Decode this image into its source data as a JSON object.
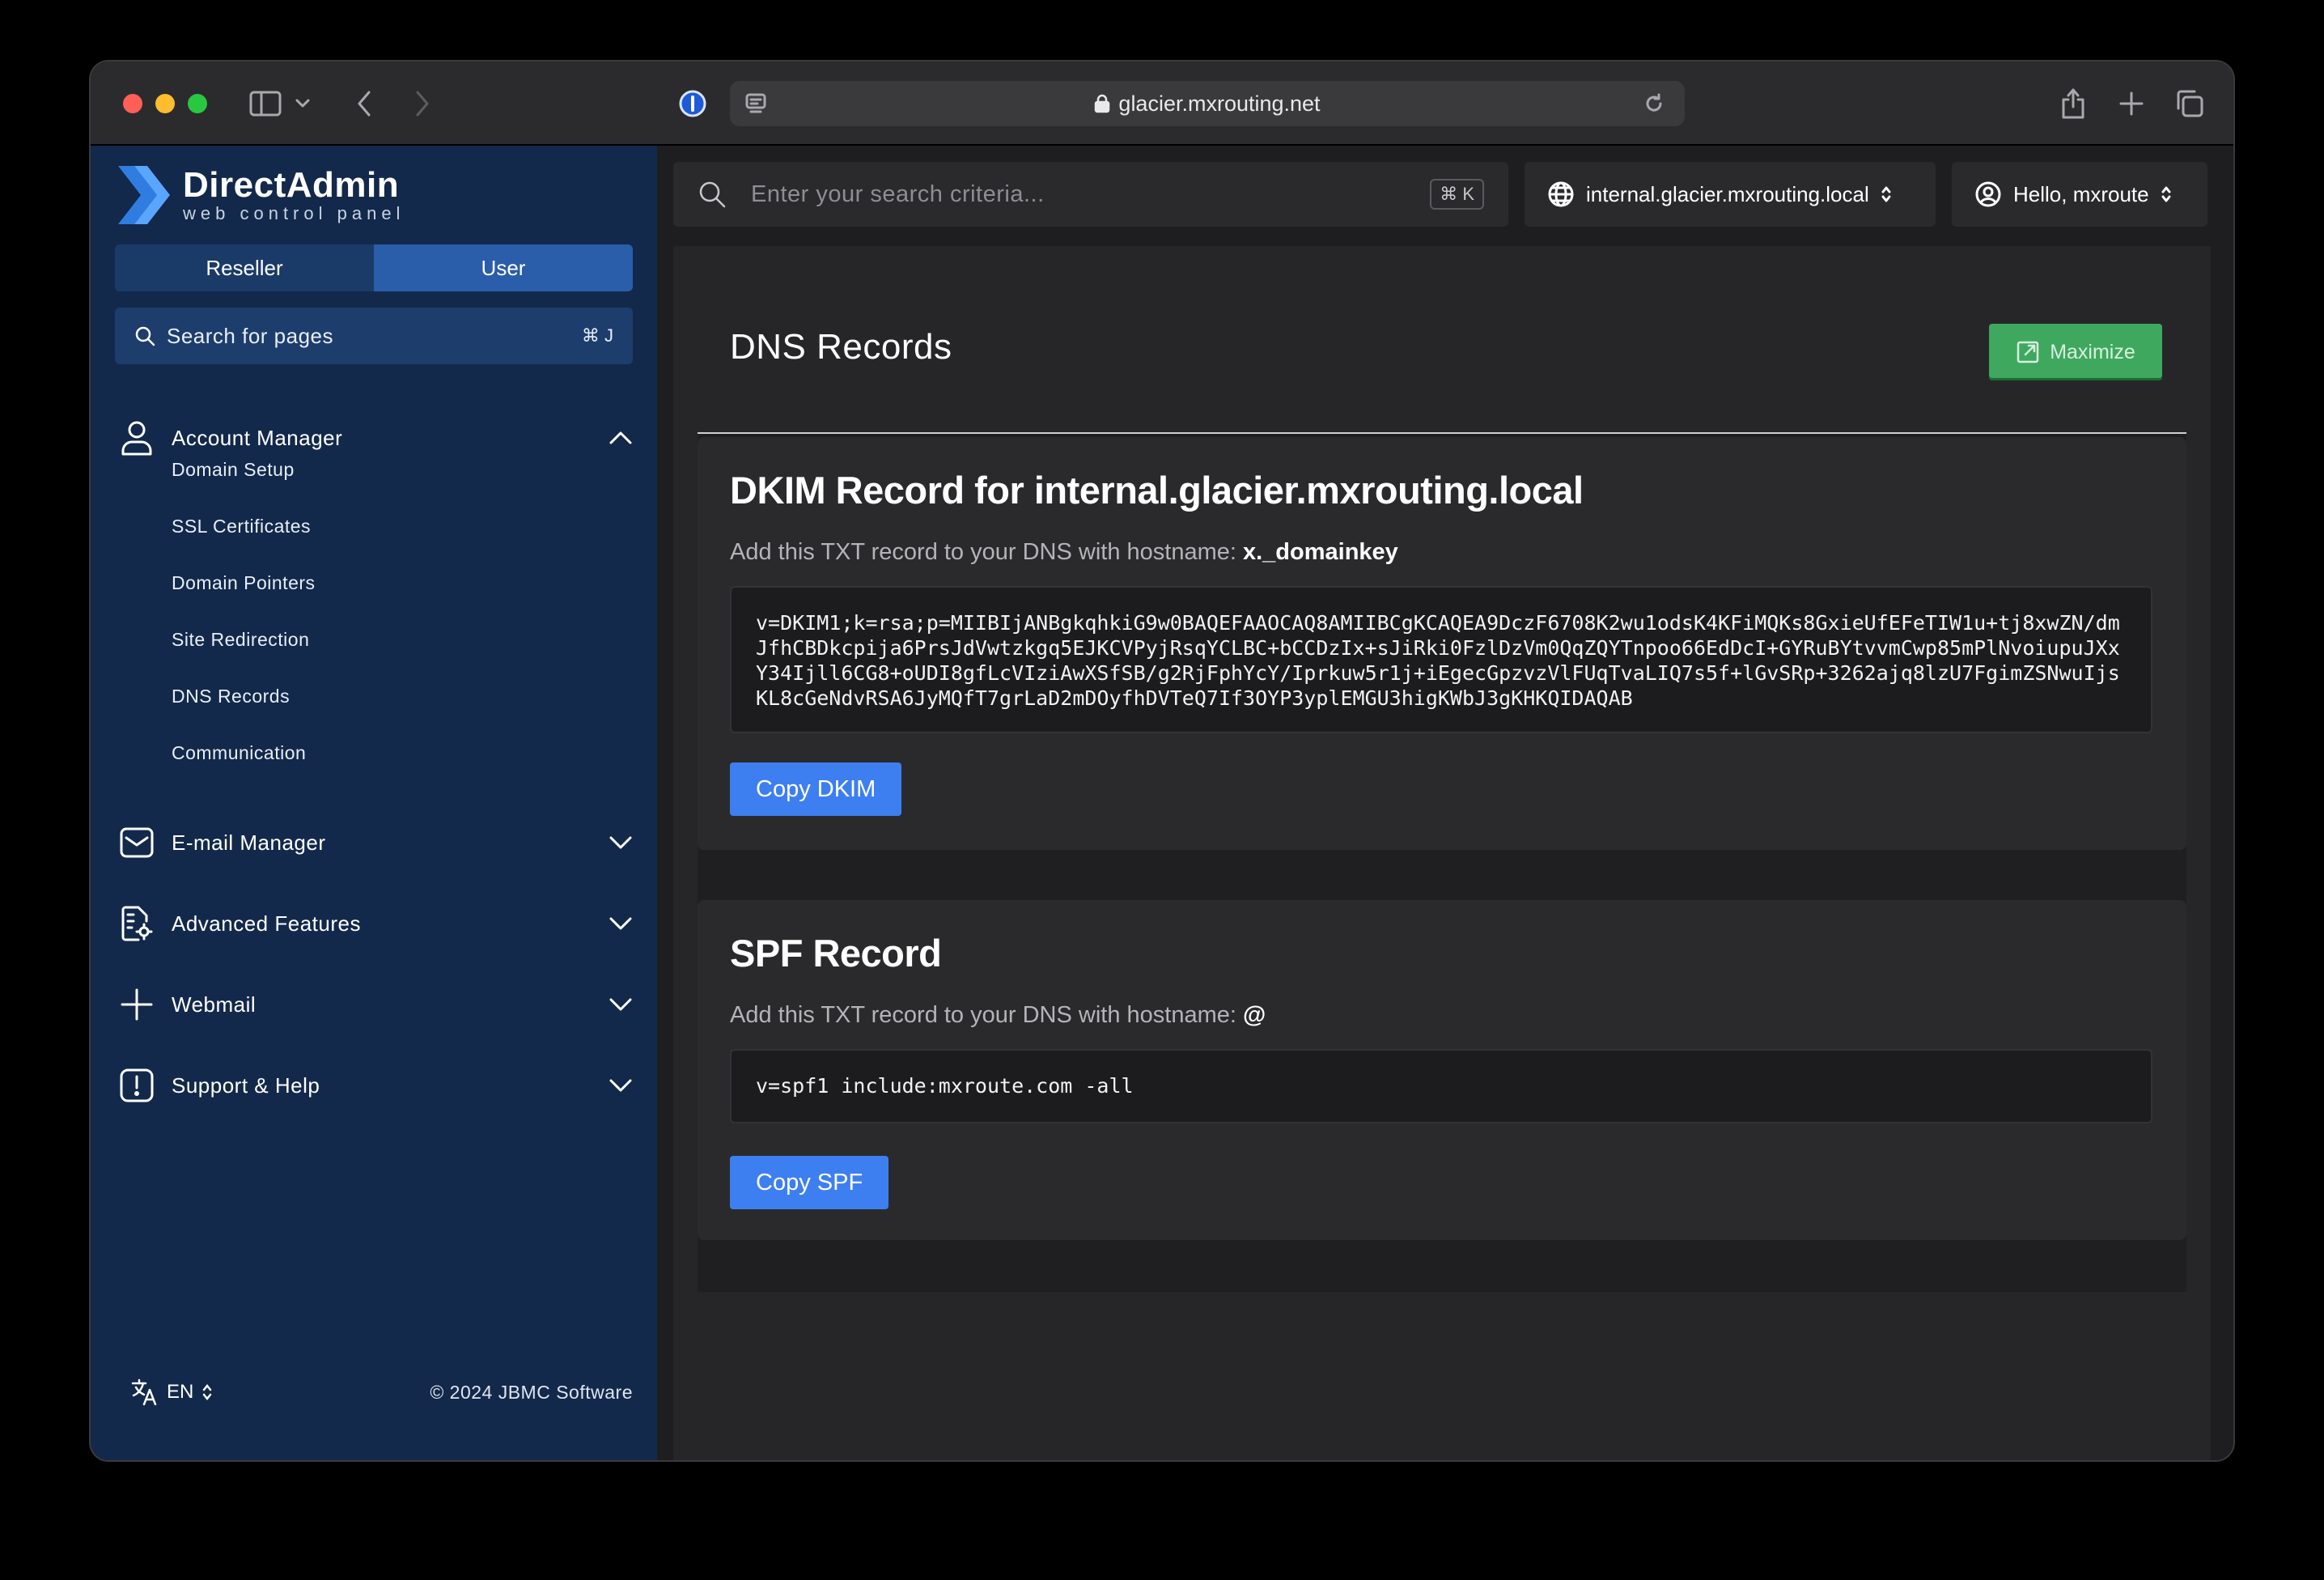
{
  "browser": {
    "url": "glacier.mxrouting.net"
  },
  "brand": {
    "title": "DirectAdmin",
    "subtitle": "web control panel"
  },
  "sidebar": {
    "tabs": [
      {
        "label": "Reseller",
        "active": false
      },
      {
        "label": "User",
        "active": true
      }
    ],
    "search": {
      "label": "Search for pages",
      "shortcut": "⌘ J"
    },
    "account_manager": {
      "label": "Account Manager",
      "items": [
        {
          "label": "Domain Setup"
        },
        {
          "label": "SSL Certificates"
        },
        {
          "label": "Domain Pointers"
        },
        {
          "label": "Site Redirection"
        },
        {
          "label": "DNS Records"
        },
        {
          "label": "Communication"
        }
      ]
    },
    "groups": [
      {
        "label": "E-mail Manager",
        "icon": "mail-icon"
      },
      {
        "label": "Advanced Features",
        "icon": "advanced-features-icon"
      },
      {
        "label": "Webmail",
        "icon": "plus-icon"
      },
      {
        "label": "Support & Help",
        "icon": "alert-icon"
      }
    ],
    "footer": {
      "language": "EN",
      "copyright": "© 2024 JBMC Software"
    }
  },
  "header": {
    "search_placeholder": "Enter your search criteria...",
    "search_shortcut": "⌘ K",
    "domain": "internal.glacier.mxrouting.local",
    "user_greeting": "Hello, mxroute"
  },
  "page": {
    "title": "DNS Records",
    "maximize_label": "Maximize"
  },
  "dkim": {
    "title": "DKIM Record for internal.glacier.mxrouting.local",
    "desc_prefix": "Add this TXT record to your DNS with hostname:",
    "hostname": "x._domainkey",
    "value": "v=DKIM1;k=rsa;p=MIIBIjANBgkqhkiG9w0BAQEFAAOCAQ8AMIIBCgKCAQEA9DczF6708K2wu1odsK4KFiMQKs8GxieUfEFeTIW1u+tj8xwZN/dmJfhCBDkcpija6PrsJdVwtzkgq5EJKCVPyjRsqYCLBC+bCCDzIx+sJiRki0FzlDzVm0QqZQYTnpoo66EdDcI+GYRuBYtvvmCwp85mPlNvoiupuJXxY34Ijll6CG8+oUDI8gfLcVIziAwXSfSB/g2RjFphYcY/Iprkuw5r1j+iEgecGpzvzVlFUqTvaLIQ7s5f+lGvSRp+3262ajq8lzU7FgimZSNwuIjsKL8cGeNdvRSA6JyMQfT7grLaD2mDOyfhDVTeQ7If3OYP3yplEMGU3higKWbJ3gKHKQIDAQAB",
    "copy_label": "Copy DKIM"
  },
  "spf": {
    "title": "SPF Record",
    "desc_prefix": "Add this TXT record to your DNS with hostname:",
    "hostname": "@",
    "value": "v=spf1 include:mxroute.com -all",
    "copy_label": "Copy SPF"
  },
  "colors": {
    "sidebar_bg": "#13294b",
    "accent_blue": "#3d7ff0",
    "maximize_green": "#3fa85f",
    "main_bg": "#1e1e20"
  }
}
